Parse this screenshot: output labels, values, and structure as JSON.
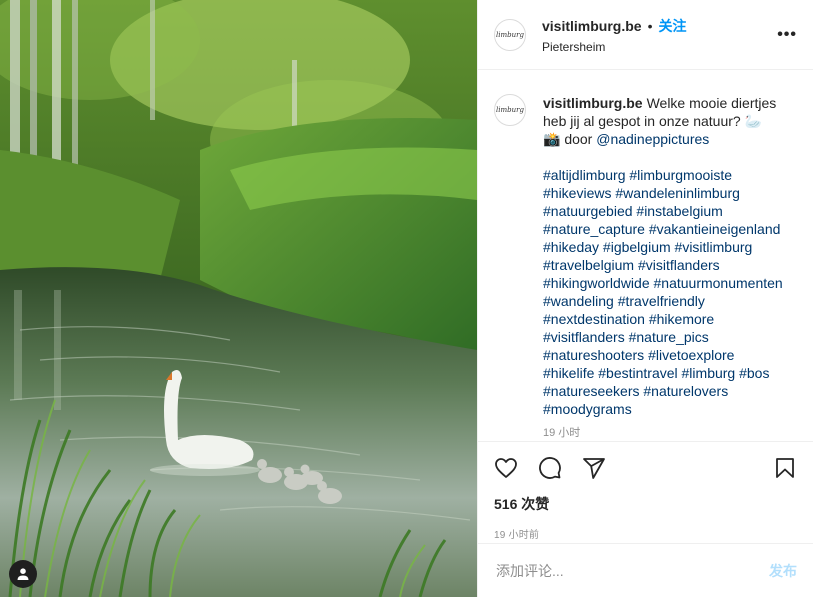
{
  "header": {
    "username": "visitlimburg.be",
    "separator": "•",
    "follow_label": "关注",
    "location": "Pietersheim",
    "more_label": "•••",
    "avatar_logo_text": "limburg"
  },
  "caption": {
    "username": "visitlimburg.be",
    "text": "Welke mooie diertjes heb jij al gespot in onze natuur? 🦢",
    "credit_prefix": "📸 door ",
    "credit_handle": "@nadineppictures",
    "hashtag_lines": [
      "#altijdlimburg #limburgmooiste",
      "#hikeviews #wandeleninlimburg",
      "#natuurgebied #instabelgium",
      "#nature_capture #vakantieineigenland",
      "#hikeday #igbelgium #visitlimburg",
      "#travelbelgium #visitflanders",
      "#hikingworldwide #natuurmonumenten",
      "#wandeling #travelfriendly",
      "#nextdestination #hikemore",
      "#visitflanders #nature_pics",
      "#natureshooters #livetoexplore",
      "#hikelife #bestintravel #limburg #bos",
      "#natureseekers #naturelovers",
      "#moodygrams"
    ],
    "partial_timestamp": "19 小时"
  },
  "actions": {
    "likes": "516 次赞",
    "post_time": "19 小时前"
  },
  "comment": {
    "placeholder": "添加评论...",
    "post_label": "发布"
  },
  "colors": {
    "accent": "#0095f6",
    "link": "#00376b",
    "muted": "#8e8e8e",
    "post_disabled": "#b2dffc"
  }
}
